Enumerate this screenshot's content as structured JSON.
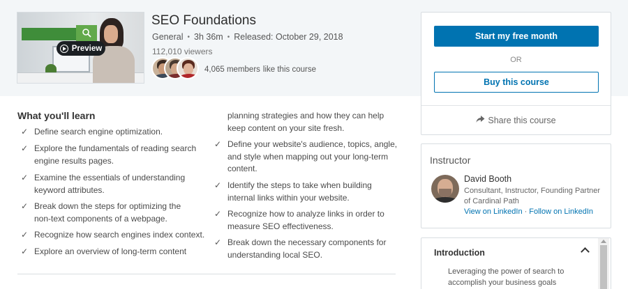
{
  "course": {
    "title": "SEO Foundations",
    "category": "General",
    "duration": "3h 36m",
    "released": "Released: October 29, 2018",
    "viewers": "112,010 viewers",
    "members_count": "4,065 members",
    "members_suffix": "like this course",
    "preview_label": "Preview"
  },
  "purchase": {
    "primary_label": "Start my free month",
    "or_label": "OR",
    "buy_label": "Buy this course",
    "share_label": "Share this course"
  },
  "learn": {
    "heading": "What you'll learn",
    "left": [
      "Define search engine optimization.",
      "Explore the fundamentals of reading search engine results pages.",
      "Examine the essentials of understanding keyword attributes.",
      "Break down the steps for optimizing the non-text components of a webpage.",
      "Recognize how search engines index context.",
      "Explore an overview of long-term content"
    ],
    "right_continuation": "planning strategies and how they can help keep content on your site fresh.",
    "right": [
      "Define your website's audience, topics, angle, and style when mapping out your long-term content.",
      "Identify the steps to take when building internal links within your website.",
      "Recognize how to analyze links in order to measure SEO effectiveness.",
      "Break down the necessary components for understanding local SEO."
    ]
  },
  "instructor": {
    "heading": "Instructor",
    "name": "David Booth",
    "role": "Consultant, Instructor, Founding Partner of Cardinal Path",
    "link_linkedin": "View on LinkedIn",
    "separator": "·",
    "link_follow": "Follow on LinkedIn"
  },
  "toc": {
    "heading": "Introduction",
    "first_item": "Leveraging the power of search to accomplish your business goals"
  },
  "colors": {
    "accent": "#0073b1",
    "hero_bg": "#f3f6f8"
  },
  "icons": {
    "check": "✓",
    "share": "share-arrow-icon",
    "chevron": "chevron-up-icon",
    "play": "play-icon"
  }
}
